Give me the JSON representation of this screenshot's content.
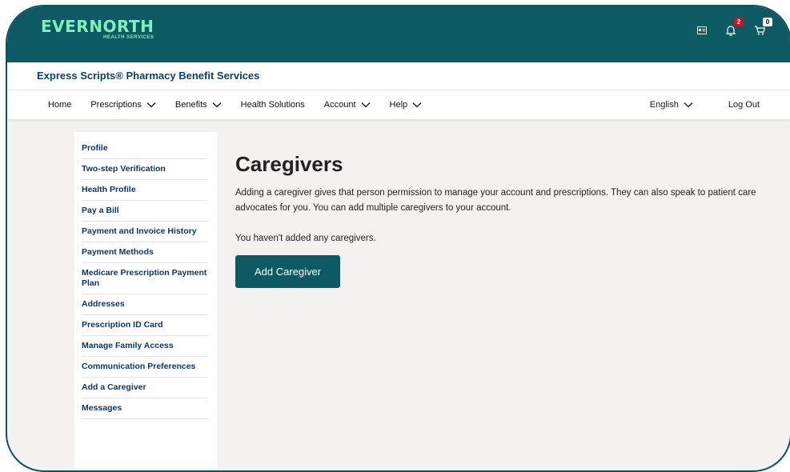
{
  "header": {
    "logo_text": "EVERNORTH",
    "logo_sub": "HEALTH SERVICES",
    "notifications_count": "2",
    "cart_count": "0"
  },
  "brand": {
    "title": "Express Scripts® Pharmacy Benefit Services"
  },
  "nav": {
    "items": [
      {
        "label": "Home"
      },
      {
        "label": "Prescriptions"
      },
      {
        "label": "Benefits"
      },
      {
        "label": "Health Solutions"
      },
      {
        "label": "Account"
      },
      {
        "label": "Help"
      }
    ],
    "language": "English",
    "logout": "Log Out"
  },
  "sidebar": {
    "items": [
      {
        "label": "Profile"
      },
      {
        "label": "Two-step Verification"
      },
      {
        "label": "Health Profile"
      },
      {
        "label": "Pay a Bill"
      },
      {
        "label": "Payment and Invoice History"
      },
      {
        "label": "Payment Methods"
      },
      {
        "label": "Medicare Prescription Payment Plan"
      },
      {
        "label": "Addresses"
      },
      {
        "label": "Prescription ID Card"
      },
      {
        "label": "Manage Family Access"
      },
      {
        "label": "Communication Preferences"
      },
      {
        "label": "Add a Caregiver"
      },
      {
        "label": "Messages"
      }
    ]
  },
  "main": {
    "title": "Caregivers",
    "intro": "Adding a caregiver gives that person permission to manage your account and prescriptions. They can also speak to patient care advocates for you. You can add multiple caregivers to your account.",
    "empty_message": "You haven't added any caregivers.",
    "add_button": "Add Caregiver"
  },
  "colors": {
    "brand_teal": "#0d5a64",
    "logo_green": "#7ef0b8",
    "nav_text_blue": "#0d3569",
    "badge_red": "#c7171d"
  }
}
